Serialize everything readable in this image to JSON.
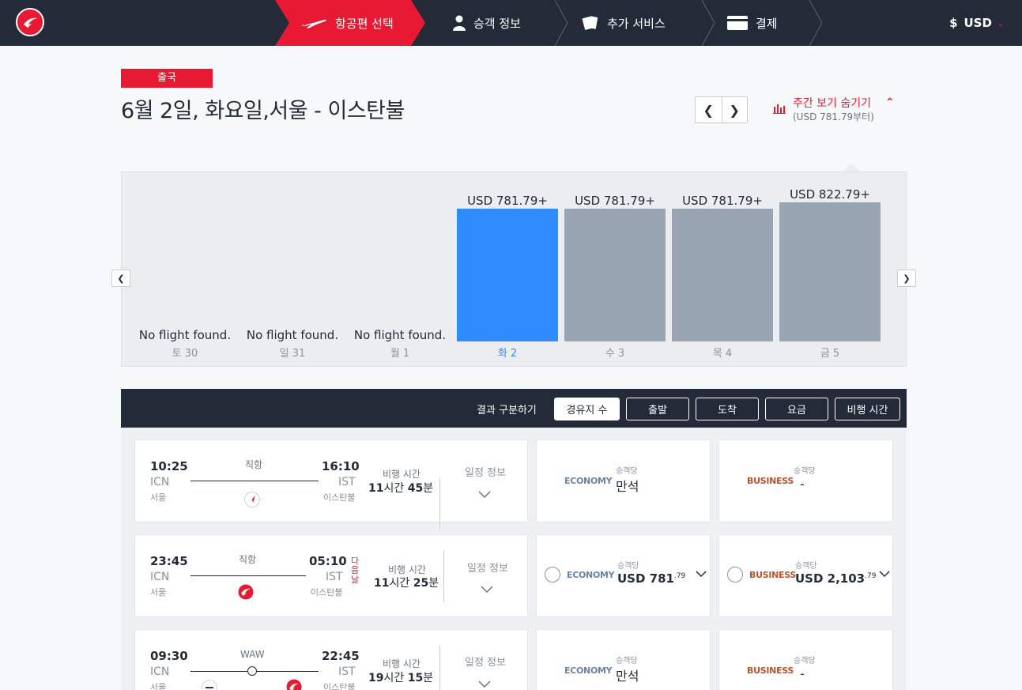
{
  "nav": {
    "steps": [
      {
        "label": "항공편 선택",
        "icon": "plane-icon",
        "active": true
      },
      {
        "label": "승객 정보",
        "icon": "person-icon"
      },
      {
        "label": "추가 서비스",
        "icon": "ticket-icon"
      },
      {
        "label": "결제",
        "icon": "card-icon"
      }
    ],
    "currency_symbol": "$",
    "currency": "USD",
    "colors": {
      "brand": "#e81932",
      "dark": "#232b38",
      "selected_bar": "#2f8cff",
      "bar": "#9aa5b4"
    }
  },
  "header": {
    "badge": "출국",
    "title": "6월 2일, 화요일,서울 - 이스탄불",
    "week_toggle": "주간 보기 숨기기",
    "week_toggle_sub": "(USD 781.79부터)"
  },
  "chart_data": {
    "type": "bar",
    "categories": [
      "토 30",
      "일 31",
      "월 1",
      "화 2",
      "수 3",
      "목 4",
      "금 5"
    ],
    "values": [
      null,
      null,
      null,
      781.79,
      781.79,
      781.79,
      822.79
    ],
    "price_labels": [
      "",
      "",
      "",
      "USD 781.79+",
      "USD 781.79+",
      "USD 781.79+",
      "USD 822.79+"
    ],
    "no_flight_text": "No flight found.",
    "selected_index": 3,
    "ylim": [
      0,
      830
    ]
  },
  "sort": {
    "label": "결과 구분하기",
    "options": [
      "경유지 수",
      "출발",
      "도착",
      "요금",
      "비행 시간"
    ],
    "active_index": 0
  },
  "flights": [
    {
      "dep_time": "10:25",
      "dep_code": "ICN",
      "dep_city": "서울",
      "arr_time": "16:10",
      "arr_code": "IST",
      "arr_city": "이스탄불",
      "route": "직항",
      "duration_label": "비행 시간",
      "duration_h": "11",
      "duration_h_unit": "시간",
      "duration_m": "45",
      "duration_m_unit": "분",
      "details": "일정 정보",
      "economy": {
        "name": "ECONOMY",
        "per": "승객당",
        "value": "만석"
      },
      "business": {
        "name": "BUSINESS",
        "per": "승객당",
        "value": "-"
      }
    },
    {
      "dep_time": "23:45",
      "dep_code": "ICN",
      "dep_city": "서울",
      "arr_time": "05:10",
      "arr_code": "IST",
      "arr_city": "이스탄불",
      "next_day": "다음 날",
      "route": "직항",
      "duration_label": "비행 시간",
      "duration_h": "11",
      "duration_h_unit": "시간",
      "duration_m": "25",
      "duration_m_unit": "분",
      "details": "일정 정보",
      "economy": {
        "name": "ECONOMY",
        "per": "승객당",
        "price_main": "USD 781",
        "price_cents": ".79"
      },
      "business": {
        "name": "BUSINESS",
        "per": "승객당",
        "price_main": "USD 2,103",
        "price_cents": ".79"
      }
    },
    {
      "dep_time": "09:30",
      "dep_code": "ICN",
      "dep_city": "서울",
      "arr_time": "22:45",
      "arr_code": "IST",
      "arr_city": "이스탄불",
      "route": "WAW",
      "duration_label": "비행 시간",
      "duration_h": "19",
      "duration_h_unit": "시간",
      "duration_m": "15",
      "duration_m_unit": "분",
      "details": "일정 정보",
      "economy": {
        "name": "ECONOMY",
        "per": "승객당",
        "value": "만석"
      },
      "business": {
        "name": "BUSINESS",
        "per": "승객당",
        "value": "-"
      }
    }
  ]
}
